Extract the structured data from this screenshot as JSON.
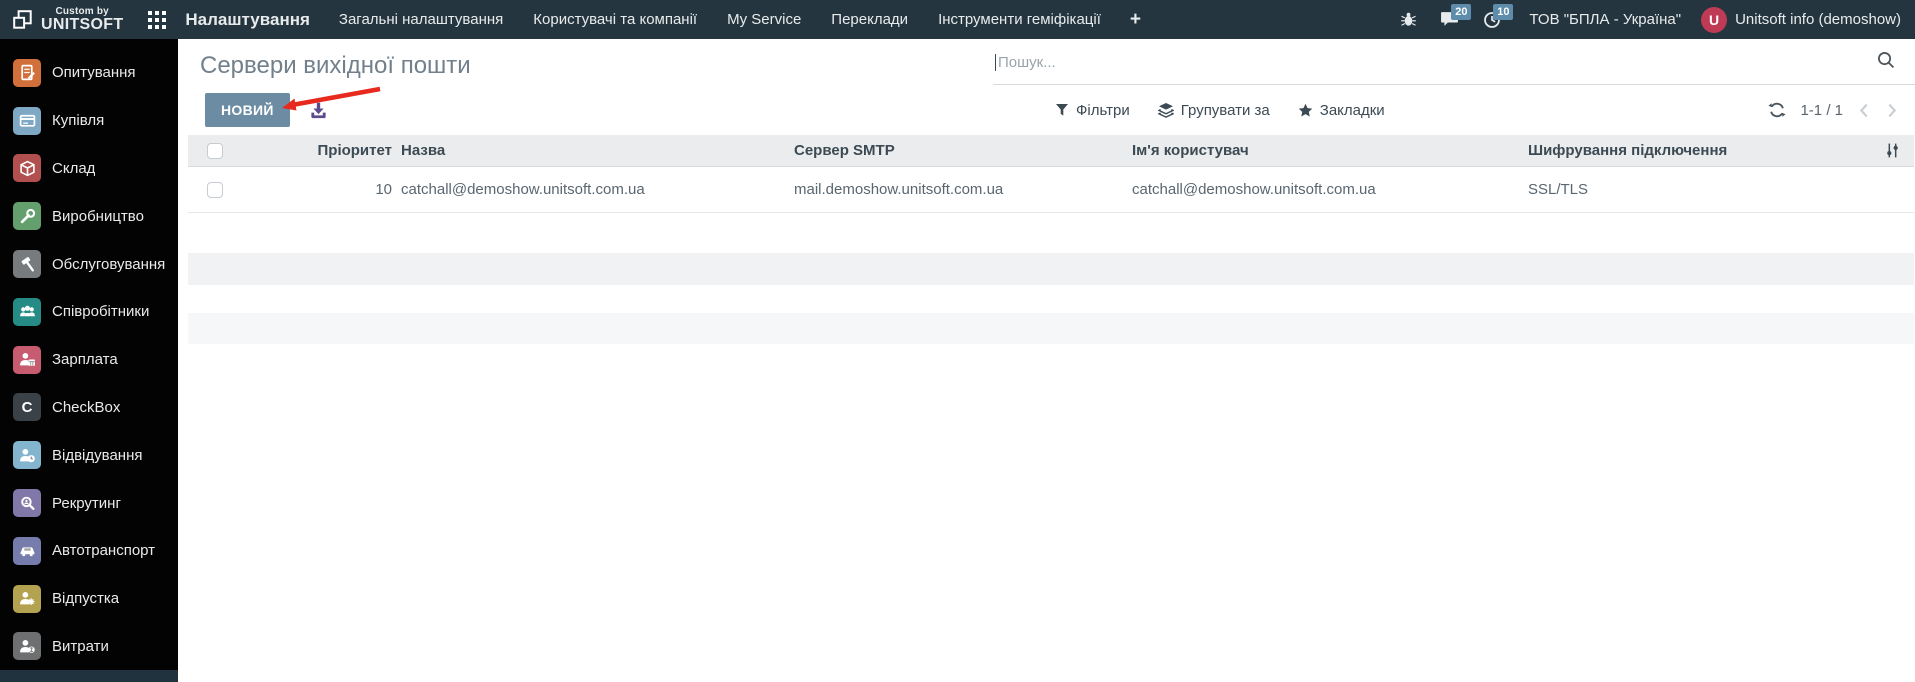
{
  "navbar": {
    "logo_custom_by": "Custom by",
    "logo_brand": "UNITSOFT",
    "app_title": "Налаштування",
    "menu_items": [
      "Загальні налаштування",
      "Користувачі та компанії",
      "My Service",
      "Переклади",
      "Інструменти геміфікації"
    ],
    "plus_label": "+",
    "messages_count": "20",
    "activities_count": "10",
    "company_name": "ТОВ \"БПЛА - Україна\"",
    "avatar_letter": "U",
    "user_name": "Unitsoft info (demoshow)"
  },
  "sidebar": {
    "items": [
      {
        "label": "Опитування",
        "color": "#d2703b",
        "icon": "survey-icon"
      },
      {
        "label": "Купівля",
        "color": "#7fa8c5",
        "icon": "purchase-icon"
      },
      {
        "label": "Склад",
        "color": "#b25050",
        "icon": "inventory-icon"
      },
      {
        "label": "Виробництво",
        "color": "#63a06e",
        "icon": "manufacturing-icon"
      },
      {
        "label": "Обслуговування",
        "color": "#777b7e",
        "icon": "maintenance-icon"
      },
      {
        "label": "Співробітники",
        "color": "#268b85",
        "icon": "employees-icon"
      },
      {
        "label": "Зарплата",
        "color": "#c75b70",
        "icon": "payroll-icon"
      },
      {
        "label": "CheckBox",
        "color": "#3a4147",
        "icon": "checkbox-app-icon",
        "icon_letter": "C"
      },
      {
        "label": "Відвідування",
        "color": "#83b5cf",
        "icon": "attendance-icon"
      },
      {
        "label": "Рекрутинг",
        "color": "#8177a8",
        "icon": "recruitment-icon"
      },
      {
        "label": "Автотранспорт",
        "color": "#767cab",
        "icon": "fleet-icon"
      },
      {
        "label": "Відпустка",
        "color": "#b3a24f",
        "icon": "timeoff-icon"
      },
      {
        "label": "Витрати",
        "color": "#6d6f71",
        "icon": "expenses-icon"
      }
    ]
  },
  "control_panel": {
    "title": "Сервери вихідної пошти",
    "new_button_label": "НОВИЙ",
    "search_placeholder": "Пошук...",
    "filters_label": "Фільтри",
    "group_by_label": "Групувати за",
    "favorites_label": "Закладки",
    "pager_text": "1-1 / 1"
  },
  "table": {
    "headers": {
      "priority": "Пріоритет",
      "name": "Назва",
      "smtp": "Сервер SMTP",
      "username": "Ім'я користувач",
      "encryption": "Шифрування підключення"
    },
    "rows": [
      {
        "priority": "10",
        "name": "catchall@demoshow.unitsoft.com.ua",
        "smtp": "mail.demoshow.unitsoft.com.ua",
        "username": "catchall@demoshow.unitsoft.com.ua",
        "encryption": "SSL/TLS"
      }
    ]
  },
  "colors": {
    "navbar_bg": "#24353f",
    "badge_bg": "#5e8cab",
    "avatar_bg": "#bf3a54",
    "new_button_bg": "#6c8ca3",
    "import_icon": "#5d4a8f",
    "annotation_arrow": "#e8291d"
  }
}
